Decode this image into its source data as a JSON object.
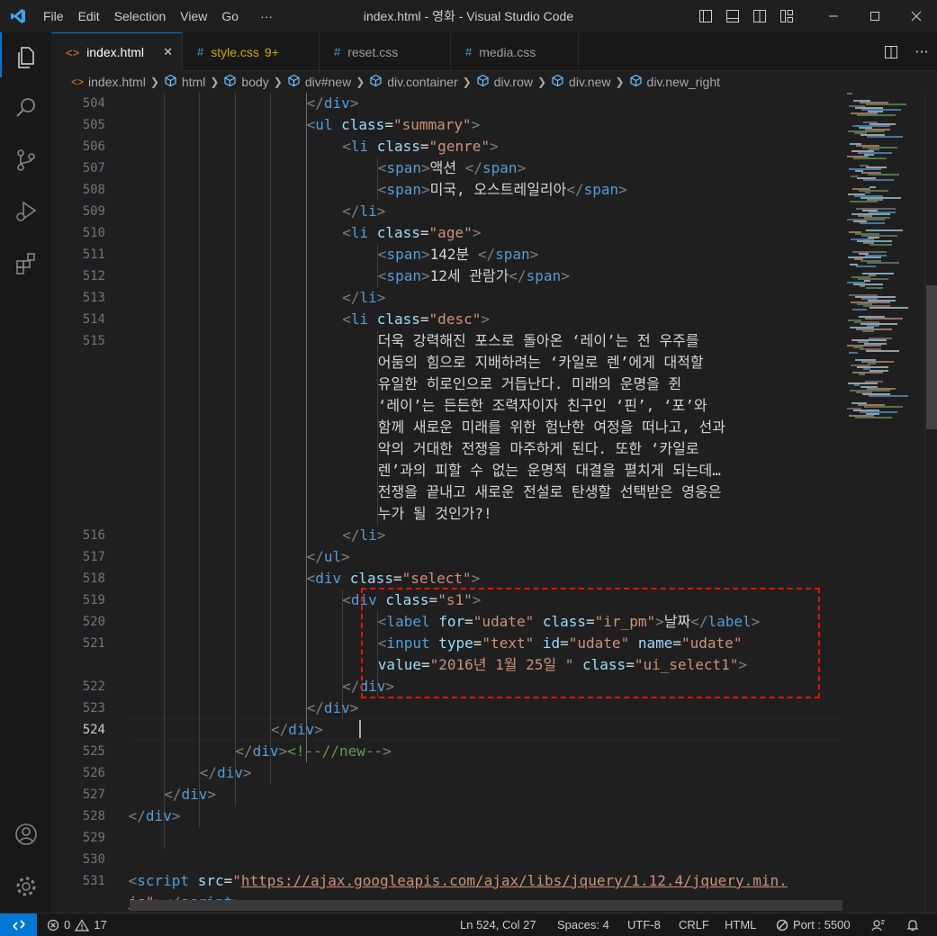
{
  "window": {
    "title": "index.html - 영화 - Visual Studio Code",
    "menu": [
      "File",
      "Edit",
      "Selection",
      "View",
      "Go",
      "···"
    ]
  },
  "tabs": [
    {
      "icon": "html-file-icon",
      "label": "index.html",
      "badge": "",
      "active": true
    },
    {
      "icon": "css-file-icon",
      "label": "style.css",
      "badge": "9+",
      "active": false
    },
    {
      "icon": "css-file-icon",
      "label": "reset.css",
      "badge": "",
      "active": false
    },
    {
      "icon": "css-file-icon",
      "label": "media.css",
      "badge": "",
      "active": false
    }
  ],
  "breadcrumb": [
    "index.html",
    "html",
    "body",
    "div#new",
    "div.container",
    "div.row",
    "div.new",
    "div.new_right"
  ],
  "editor": {
    "line_numbers": [
      "504",
      "505",
      "506",
      "507",
      "508",
      "509",
      "510",
      "511",
      "512",
      "513",
      "514",
      "515",
      "",
      "",
      "",
      "",
      "",
      "",
      "",
      "",
      "516",
      "517",
      "518",
      "519",
      "520",
      "521",
      "",
      "522",
      "523",
      "524",
      "525",
      "526",
      "527",
      "528",
      "529",
      "530",
      "531",
      ""
    ],
    "current_line": "524"
  },
  "status": {
    "errors": "0",
    "warnings": "17",
    "position": "Ln 524, Col 27",
    "spaces": "Spaces: 4",
    "encoding": "UTF-8",
    "eol": "CRLF",
    "language": "HTML",
    "port": "Port : 5500"
  },
  "colors": {
    "accent": "#0078d4",
    "highlight_box": "#e51400",
    "tag": "#569cd6",
    "attribute": "#9cdcfe",
    "string": "#ce9178",
    "comment": "#6a9955",
    "style_css_tab": "#cca700"
  }
}
